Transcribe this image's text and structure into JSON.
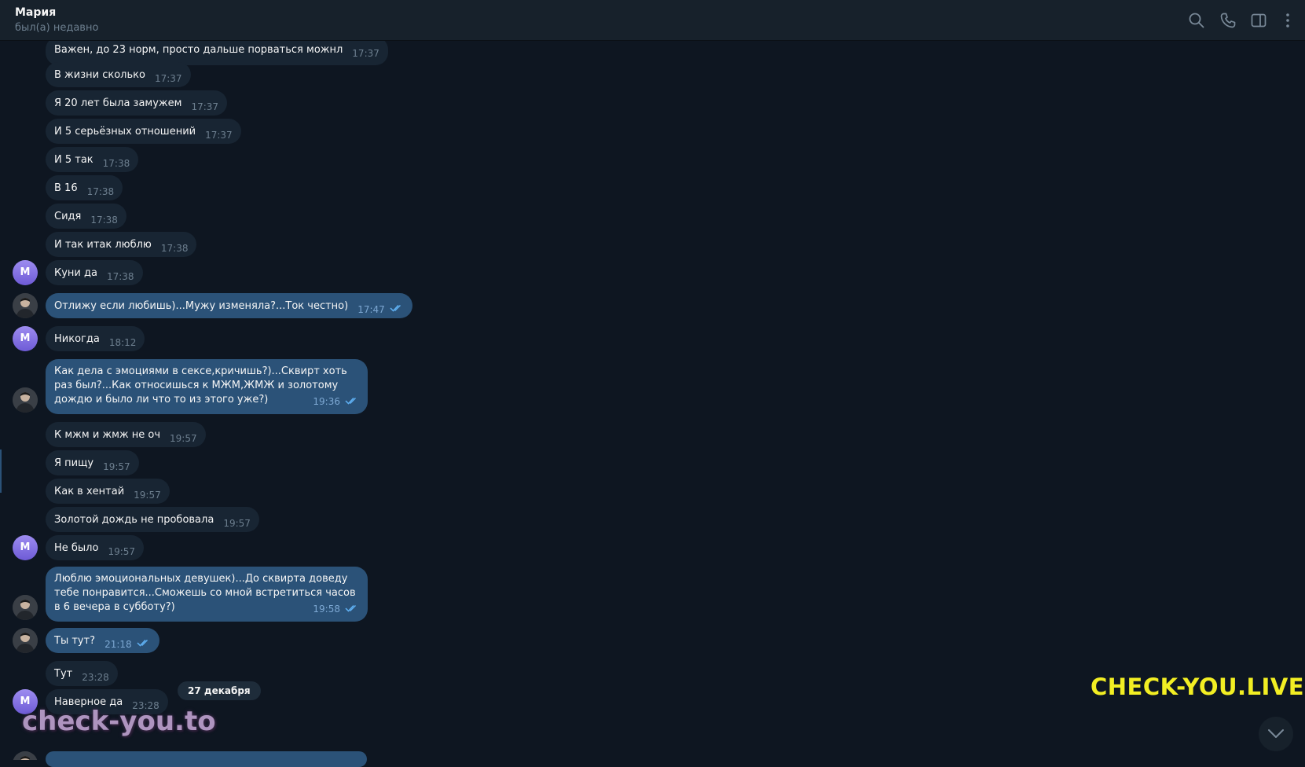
{
  "header": {
    "name": "Мария",
    "status": "был(а) недавно",
    "icons": [
      "search-icon",
      "phone-icon",
      "sidebar-icon",
      "more-icon"
    ]
  },
  "contact_avatar_letter": "М",
  "messages": [
    {
      "text": "Важен, до 23 норм, просто дальше порваться можнл",
      "time": "17:37",
      "dir": "in"
    },
    {
      "text": "В жизни сколько",
      "time": "17:37",
      "dir": "in"
    },
    {
      "text": "Я 20 лет была замужем",
      "time": "17:37",
      "dir": "in"
    },
    {
      "text": "И 5 серьёзных отношений",
      "time": "17:37",
      "dir": "in"
    },
    {
      "text": "И 5 так",
      "time": "17:38",
      "dir": "in"
    },
    {
      "text": "В 16",
      "time": "17:38",
      "dir": "in"
    },
    {
      "text": "Сидя",
      "time": "17:38",
      "dir": "in"
    },
    {
      "text": "И так итак люблю",
      "time": "17:38",
      "dir": "in"
    },
    {
      "text": "Куни да",
      "time": "17:38",
      "dir": "in"
    },
    {
      "text": "Отлижу если любишь)...Мужу изменяла?...Ток честно)",
      "time": "17:47",
      "dir": "out"
    },
    {
      "text": "Никогда",
      "time": "18:12",
      "dir": "in"
    },
    {
      "text": "Как дела с эмоциями в сексе,кричишь?)...Сквирт хоть раз был?...Как относишься к МЖМ,ЖМЖ и золотому дождю и было ли что то из этого уже?)",
      "time": "19:36",
      "dir": "out"
    },
    {
      "text": "К мжм и жмж не оч",
      "time": "19:57",
      "dir": "in"
    },
    {
      "text": "Я пищу",
      "time": "19:57",
      "dir": "in"
    },
    {
      "text": "Как в хентай",
      "time": "19:57",
      "dir": "in"
    },
    {
      "text": "Золотой дождь не пробовала",
      "time": "19:57",
      "dir": "in"
    },
    {
      "text": "Не было",
      "time": "19:57",
      "dir": "in"
    },
    {
      "text": "Люблю эмоциональных девушек)...До сквирта доведу тебе понравится...Сможешь со мной встретиться часов в 6 вечера в субботу?)",
      "time": "19:58",
      "dir": "out"
    },
    {
      "text": "Ты тут?",
      "time": "21:18",
      "dir": "out"
    },
    {
      "text": "Тут",
      "time": "23:28",
      "dir": "in"
    },
    {
      "text": "Наверное да",
      "time": "23:28",
      "dir": "in"
    }
  ],
  "date_separator": "27 декабря",
  "watermarks": {
    "top": "CHECK-YOU.LIVE",
    "bottom": "check-you.to"
  },
  "colors": {
    "background": "#0e1621",
    "header": "#17212b",
    "incoming": "#182533",
    "outgoing": "#2b5278",
    "time": "#6d7f8f",
    "read_ticks": "#5fb0f2",
    "watermark_yellow": "#f2ee23"
  }
}
